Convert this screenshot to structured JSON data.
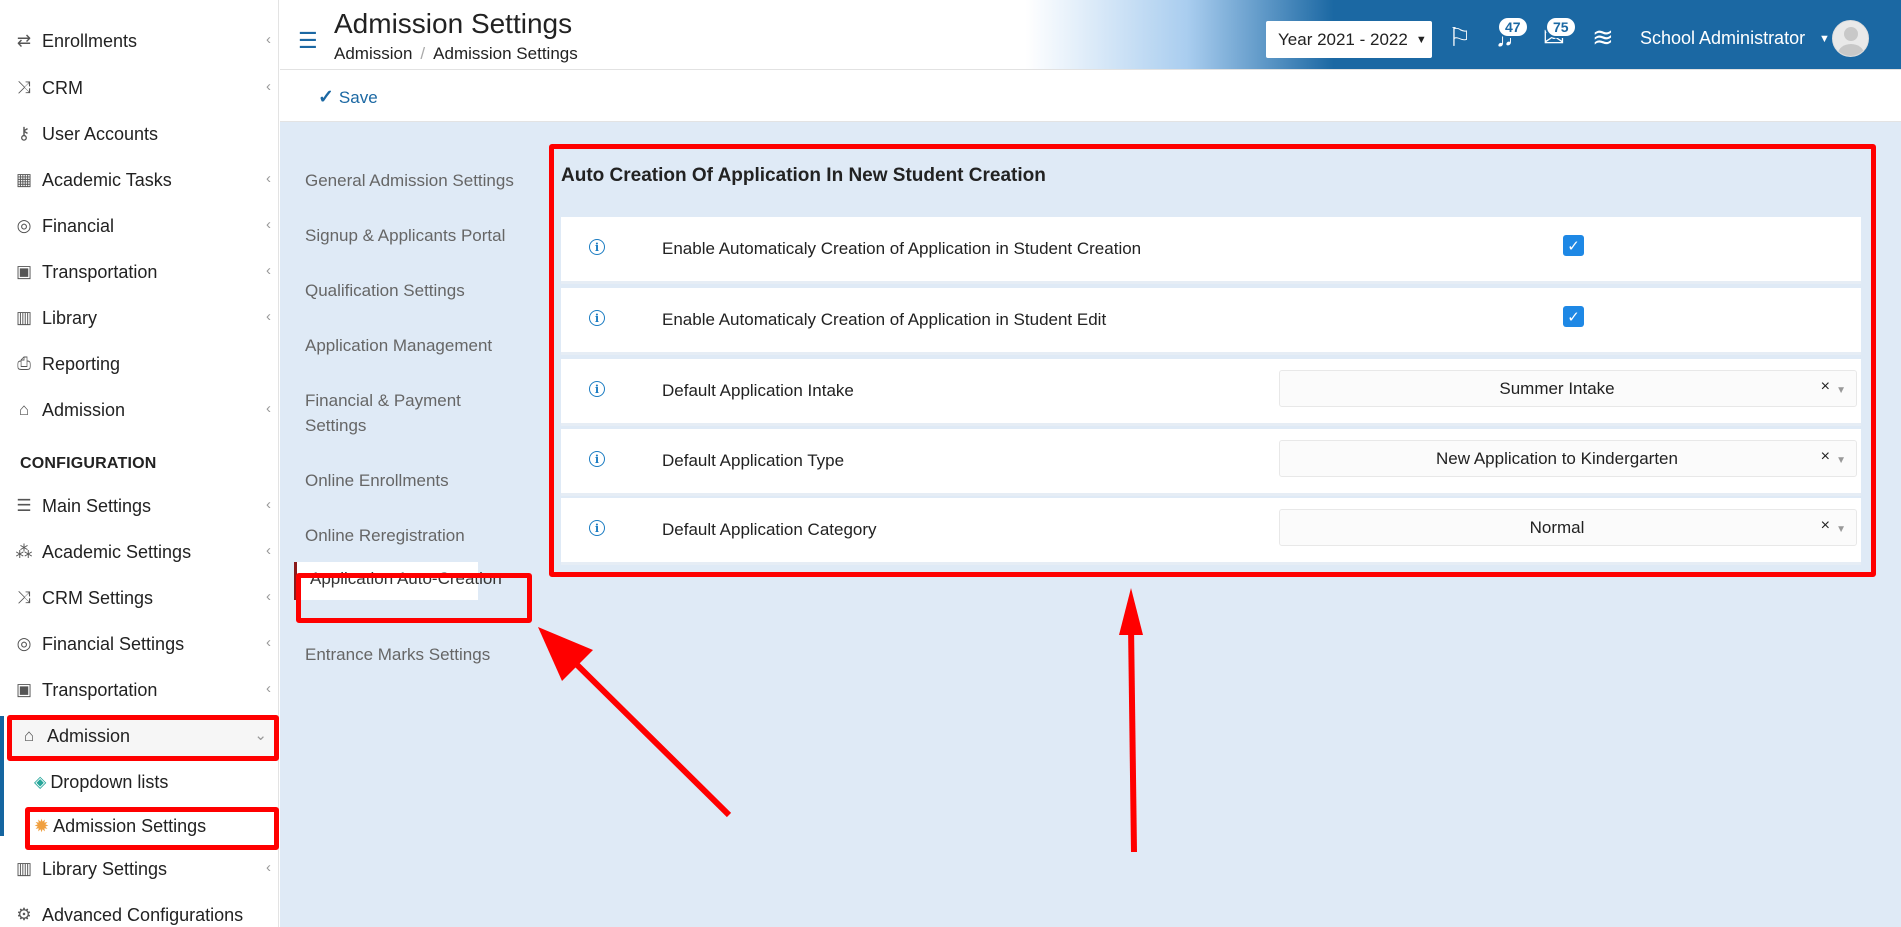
{
  "sidebar": {
    "items": [
      {
        "label": "Enrollments",
        "icon": "exchange-icon"
      },
      {
        "label": "CRM",
        "icon": "shuffle-icon"
      },
      {
        "label": "User Accounts",
        "icon": "key-icon"
      },
      {
        "label": "Academic Tasks",
        "icon": "grid-icon"
      },
      {
        "label": "Financial",
        "icon": "coins-icon"
      },
      {
        "label": "Transportation",
        "icon": "bus-icon"
      },
      {
        "label": "Library",
        "icon": "books-icon"
      },
      {
        "label": "Reporting",
        "icon": "printer-icon"
      },
      {
        "label": "Admission",
        "icon": "institution-icon"
      }
    ],
    "section_title": "CONFIGURATION",
    "config_items": [
      {
        "label": "Main Settings",
        "icon": "sliders-icon"
      },
      {
        "label": "Academic Settings",
        "icon": "users-icon"
      },
      {
        "label": "CRM Settings",
        "icon": "shuffle-icon"
      },
      {
        "label": "Financial Settings",
        "icon": "coins-icon"
      },
      {
        "label": "Transportation",
        "icon": "bus-icon"
      },
      {
        "label": "Admission",
        "icon": "institution-icon"
      }
    ],
    "sub_items": [
      {
        "label": "Dropdown lists",
        "icon": "layers-icon"
      },
      {
        "label": "Admission Settings",
        "icon": "gear-icon"
      }
    ],
    "bottom_items": [
      {
        "label": "Library Settings",
        "icon": "books-icon"
      },
      {
        "label": "Advanced Configurations",
        "icon": "gears-icon"
      }
    ]
  },
  "header": {
    "title": "Admission Settings",
    "breadcrumb": [
      "Admission",
      "Admission Settings"
    ],
    "year": "Year 2021 - 2022",
    "notifications_count": "47",
    "messages_count": "75",
    "user_name": "School Administrator"
  },
  "toolbar": {
    "save_label": "Save"
  },
  "nav": {
    "items": [
      "General Admission Settings",
      "Signup & Applicants Portal",
      "Qualification Settings",
      "Application Management",
      "Financial & Payment Settings",
      "Online Enrollments",
      "Online Reregistration",
      "Application Auto-Creation",
      "Entrance Marks Settings"
    ],
    "active": "Application Auto-Creation"
  },
  "panel": {
    "title": "Auto Creation Of Application In New Student Creation",
    "rows": [
      {
        "label": "Enable Automaticaly Creation of Application in Student Creation",
        "type": "checkbox",
        "checked": true
      },
      {
        "label": "Enable Automaticaly Creation of Application in Student Edit",
        "type": "checkbox",
        "checked": true
      },
      {
        "label": "Default Application Intake",
        "type": "select",
        "value": "Summer Intake"
      },
      {
        "label": "Default Application Type",
        "type": "select",
        "value": "New Application to Kindergarten"
      },
      {
        "label": "Default Application Category",
        "type": "select",
        "value": "Normal"
      }
    ]
  },
  "colors": {
    "header_blue": "#1b68a3",
    "main_bg": "#dfeaf6",
    "annotation_red": "#ff0000",
    "checkbox_blue": "#1e88e5"
  }
}
